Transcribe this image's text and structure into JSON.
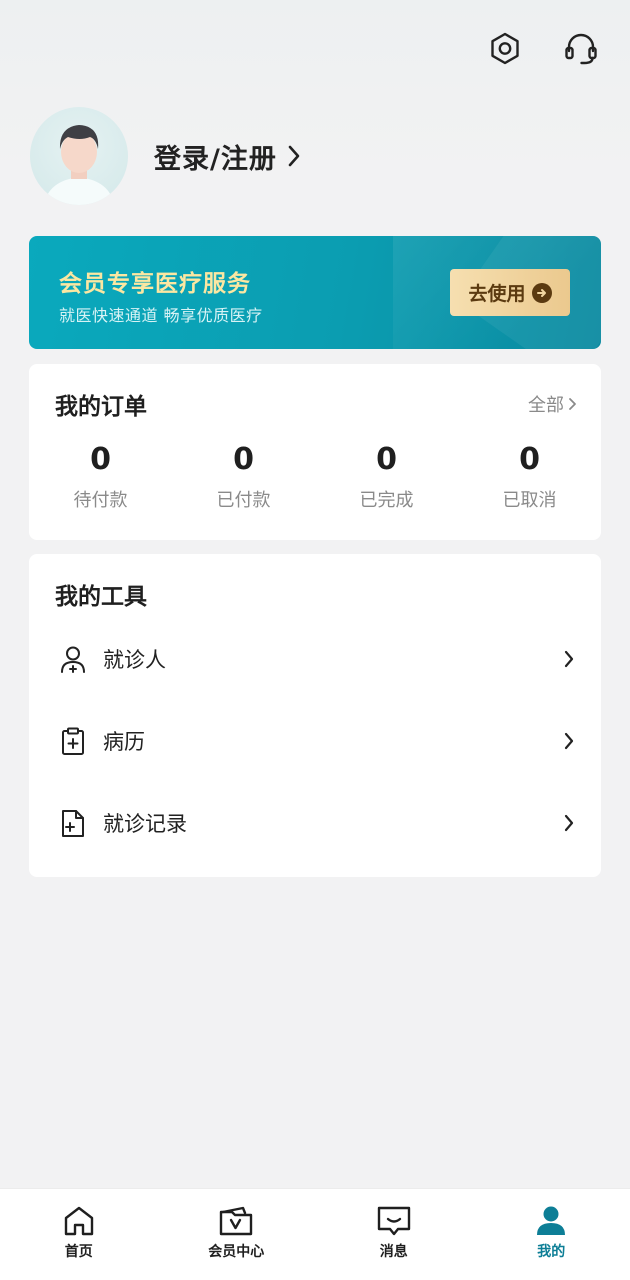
{
  "header": {
    "icons": [
      "settings-icon",
      "customer-service-icon"
    ]
  },
  "profile": {
    "login_label": "登录/注册"
  },
  "banner": {
    "title": "会员专享医疗服务",
    "subtitle": "就医快速通道 畅享优质医疗",
    "button_label": "去使用",
    "colors": {
      "background": "#0aa3b8",
      "title": "#fbe7a2",
      "button": "#f2d6a0"
    }
  },
  "orders": {
    "title": "我的订单",
    "all_label": "全部",
    "stats": [
      {
        "count": "0",
        "label": "待付款"
      },
      {
        "count": "0",
        "label": "已付款"
      },
      {
        "count": "0",
        "label": "已完成"
      },
      {
        "count": "0",
        "label": "已取消"
      }
    ]
  },
  "tools": {
    "title": "我的工具",
    "items": [
      {
        "label": "就诊人",
        "icon": "patient-icon"
      },
      {
        "label": "病历",
        "icon": "medical-record-icon"
      },
      {
        "label": "就诊记录",
        "icon": "visit-record-icon"
      }
    ]
  },
  "tabbar": {
    "items": [
      {
        "label": "首页",
        "icon": "home-icon",
        "active": false
      },
      {
        "label": "会员中心",
        "icon": "member-center-icon",
        "active": false
      },
      {
        "label": "消息",
        "icon": "message-icon",
        "active": false
      },
      {
        "label": "我的",
        "icon": "profile-icon",
        "active": true
      }
    ],
    "active_color": "#0d7e96"
  }
}
